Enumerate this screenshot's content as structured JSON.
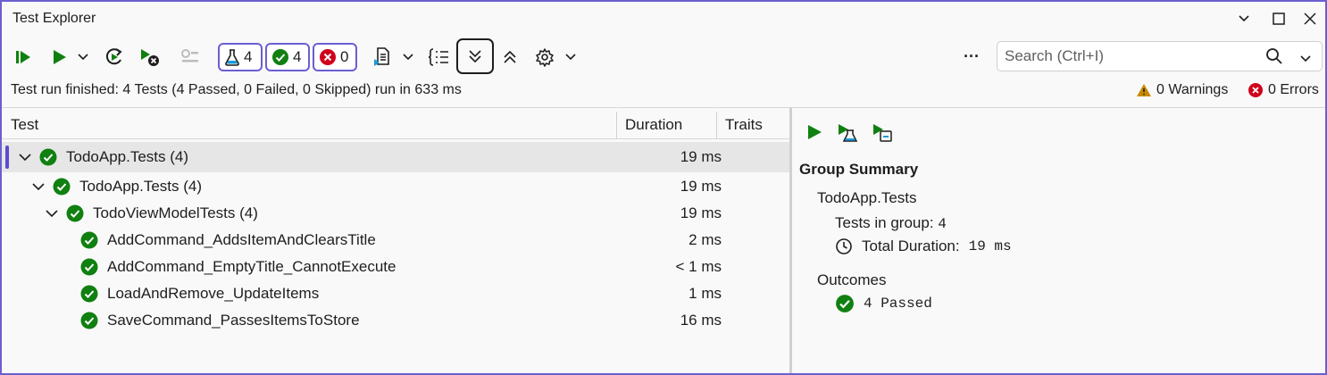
{
  "window": {
    "title": "Test Explorer"
  },
  "toolbar": {
    "badges": {
      "total": "4",
      "passed": "4",
      "failed": "0"
    },
    "search_placeholder": "Search (Ctrl+I)",
    "more_label": "···"
  },
  "status": {
    "summary": "Test run finished: 4 Tests (4 Passed, 0 Failed, 0 Skipped) run in 633 ms",
    "warnings": "0 Warnings",
    "errors": "0 Errors"
  },
  "columns": {
    "test": "Test",
    "duration": "Duration",
    "traits": "Traits"
  },
  "tree": [
    {
      "label": "TodoApp.Tests",
      "count": "(4)",
      "duration": "19 ms",
      "level": 0,
      "expandable": true
    },
    {
      "label": "TodoApp.Tests",
      "count": "(4)",
      "duration": "19 ms",
      "level": 1,
      "expandable": true
    },
    {
      "label": "TodoViewModelTests",
      "count": "(4)",
      "duration": "19 ms",
      "level": 2,
      "expandable": true
    },
    {
      "label": "AddCommand_AddsItemAndClearsTitle",
      "count": "",
      "duration": "2 ms",
      "level": 3,
      "expandable": false
    },
    {
      "label": "AddCommand_EmptyTitle_CannotExecute",
      "count": "",
      "duration": "< 1 ms",
      "level": 3,
      "expandable": false
    },
    {
      "label": "LoadAndRemove_UpdateItems",
      "count": "",
      "duration": "1 ms",
      "level": 3,
      "expandable": false
    },
    {
      "label": "SaveCommand_PassesItemsToStore",
      "count": "",
      "duration": "16 ms",
      "level": 3,
      "expandable": false
    }
  ],
  "summary": {
    "title": "Group Summary",
    "group_name": "TodoApp.Tests",
    "tests_in_group_label": "Tests in group:",
    "tests_in_group_value": "4",
    "total_duration_label": "Total Duration:",
    "total_duration_value": "19 ms",
    "outcomes_label": "Outcomes",
    "passed_value": "4 Passed"
  },
  "colors": {
    "accent": "#6b5fd0",
    "pass": "#108010",
    "fail": "#d0021b",
    "warn": "#c88a00"
  }
}
